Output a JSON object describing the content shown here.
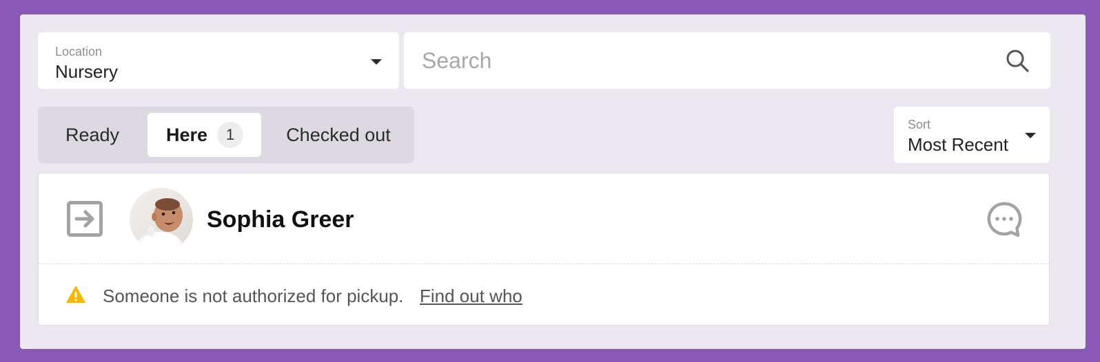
{
  "location": {
    "label": "Location",
    "value": "Nursery"
  },
  "search": {
    "placeholder": "Search"
  },
  "tabs": [
    {
      "label": "Ready"
    },
    {
      "label": "Here",
      "count": "1"
    },
    {
      "label": "Checked out"
    }
  ],
  "sort": {
    "label": "Sort",
    "value": "Most Recent"
  },
  "list": {
    "items": [
      {
        "name": "Sophia Greer",
        "alert": {
          "text": "Someone is not authorized for pickup.",
          "link": "Find out who"
        }
      }
    ]
  },
  "colors": {
    "background": "#8a5ab6",
    "panel": "#ebe8ef",
    "warning": "#f5b700"
  }
}
